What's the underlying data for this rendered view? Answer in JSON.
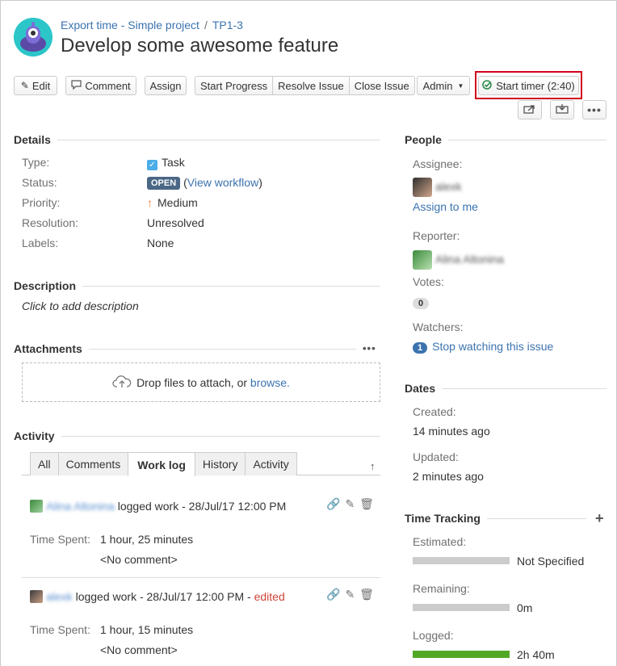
{
  "breadcrumb": {
    "project": "Export time - Simple project",
    "separator": "/",
    "issue_key": "TP1-3"
  },
  "issue": {
    "title": "Develop some awesome feature"
  },
  "toolbar": {
    "edit": "Edit",
    "comment": "Comment",
    "assign": "Assign",
    "start_progress": "Start Progress",
    "resolve_issue": "Resolve Issue",
    "close_issue": "Close Issue",
    "admin": "Admin",
    "start_timer": "Start timer (2:40)"
  },
  "details": {
    "heading": "Details",
    "type_label": "Type:",
    "type_value": "Task",
    "status_label": "Status:",
    "status_value": "OPEN",
    "view_workflow": "View workflow",
    "priority_label": "Priority:",
    "priority_value": "Medium",
    "resolution_label": "Resolution:",
    "resolution_value": "Unresolved",
    "labels_label": "Labels:",
    "labels_value": "None"
  },
  "description": {
    "heading": "Description",
    "placeholder": "Click to add description"
  },
  "attachments": {
    "heading": "Attachments",
    "drop_text": "Drop files to attach, or",
    "browse": "browse."
  },
  "activity": {
    "heading": "Activity",
    "tabs": [
      "All",
      "Comments",
      "Work log",
      "History",
      "Activity"
    ],
    "active_tab": "Work log",
    "entries": [
      {
        "user": "Alina Altonina",
        "action": "logged work - 28/Jul/17 12:00 PM",
        "edited": "",
        "time_label": "Time Spent:",
        "time_value": "1 hour, 25 minutes",
        "comment": "<No comment>"
      },
      {
        "user": "alexk",
        "action": "logged work - 28/Jul/17 12:00 PM",
        "edited": "edited",
        "time_label": "Time Spent:",
        "time_value": "1 hour, 15 minutes",
        "comment": "<No comment>"
      }
    ]
  },
  "people": {
    "heading": "People",
    "assignee_label": "Assignee:",
    "assignee": "alexk",
    "assign_to_me": "Assign to me",
    "reporter_label": "Reporter:",
    "reporter": "Alina Altonina",
    "votes_label": "Votes:",
    "votes": "0",
    "watchers_label": "Watchers:",
    "watchers_count": "1",
    "stop_watching": "Stop watching this issue"
  },
  "dates": {
    "heading": "Dates",
    "created_label": "Created:",
    "created": "14 minutes ago",
    "updated_label": "Updated:",
    "updated": "2 minutes ago"
  },
  "time_tracking": {
    "heading": "Time Tracking",
    "estimated_label": "Estimated:",
    "estimated": "Not Specified",
    "remaining_label": "Remaining:",
    "remaining": "0m",
    "logged_label": "Logged:",
    "logged": "2h 40m",
    "logged_fraction": 1.0,
    "estimated_fraction": 0,
    "remaining_fraction": 0
  },
  "colors": {
    "accent": "#3b73af",
    "status": "#4a6785",
    "logged_bar": "#51a825",
    "highlight": "#d0021b",
    "edited": "#d04437"
  }
}
